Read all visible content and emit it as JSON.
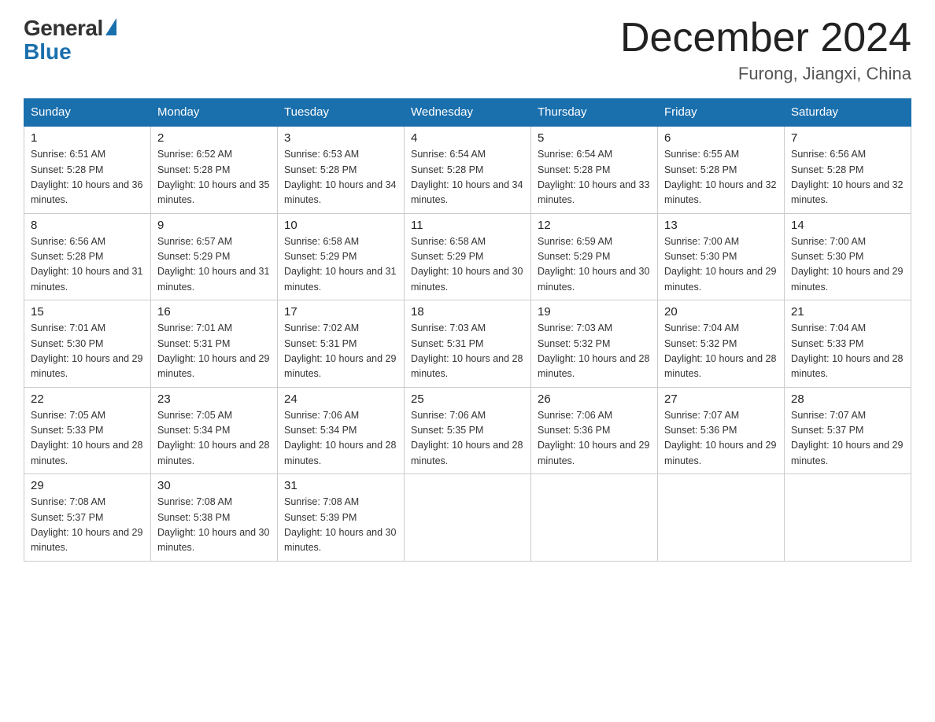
{
  "logo": {
    "general": "General",
    "blue": "Blue"
  },
  "title": {
    "month_year": "December 2024",
    "location": "Furong, Jiangxi, China"
  },
  "headers": [
    "Sunday",
    "Monday",
    "Tuesday",
    "Wednesday",
    "Thursday",
    "Friday",
    "Saturday"
  ],
  "weeks": [
    [
      {
        "day": "1",
        "sunrise": "6:51 AM",
        "sunset": "5:28 PM",
        "daylight": "10 hours and 36 minutes."
      },
      {
        "day": "2",
        "sunrise": "6:52 AM",
        "sunset": "5:28 PM",
        "daylight": "10 hours and 35 minutes."
      },
      {
        "day": "3",
        "sunrise": "6:53 AM",
        "sunset": "5:28 PM",
        "daylight": "10 hours and 34 minutes."
      },
      {
        "day": "4",
        "sunrise": "6:54 AM",
        "sunset": "5:28 PM",
        "daylight": "10 hours and 34 minutes."
      },
      {
        "day": "5",
        "sunrise": "6:54 AM",
        "sunset": "5:28 PM",
        "daylight": "10 hours and 33 minutes."
      },
      {
        "day": "6",
        "sunrise": "6:55 AM",
        "sunset": "5:28 PM",
        "daylight": "10 hours and 32 minutes."
      },
      {
        "day": "7",
        "sunrise": "6:56 AM",
        "sunset": "5:28 PM",
        "daylight": "10 hours and 32 minutes."
      }
    ],
    [
      {
        "day": "8",
        "sunrise": "6:56 AM",
        "sunset": "5:28 PM",
        "daylight": "10 hours and 31 minutes."
      },
      {
        "day": "9",
        "sunrise": "6:57 AM",
        "sunset": "5:29 PM",
        "daylight": "10 hours and 31 minutes."
      },
      {
        "day": "10",
        "sunrise": "6:58 AM",
        "sunset": "5:29 PM",
        "daylight": "10 hours and 31 minutes."
      },
      {
        "day": "11",
        "sunrise": "6:58 AM",
        "sunset": "5:29 PM",
        "daylight": "10 hours and 30 minutes."
      },
      {
        "day": "12",
        "sunrise": "6:59 AM",
        "sunset": "5:29 PM",
        "daylight": "10 hours and 30 minutes."
      },
      {
        "day": "13",
        "sunrise": "7:00 AM",
        "sunset": "5:30 PM",
        "daylight": "10 hours and 29 minutes."
      },
      {
        "day": "14",
        "sunrise": "7:00 AM",
        "sunset": "5:30 PM",
        "daylight": "10 hours and 29 minutes."
      }
    ],
    [
      {
        "day": "15",
        "sunrise": "7:01 AM",
        "sunset": "5:30 PM",
        "daylight": "10 hours and 29 minutes."
      },
      {
        "day": "16",
        "sunrise": "7:01 AM",
        "sunset": "5:31 PM",
        "daylight": "10 hours and 29 minutes."
      },
      {
        "day": "17",
        "sunrise": "7:02 AM",
        "sunset": "5:31 PM",
        "daylight": "10 hours and 29 minutes."
      },
      {
        "day": "18",
        "sunrise": "7:03 AM",
        "sunset": "5:31 PM",
        "daylight": "10 hours and 28 minutes."
      },
      {
        "day": "19",
        "sunrise": "7:03 AM",
        "sunset": "5:32 PM",
        "daylight": "10 hours and 28 minutes."
      },
      {
        "day": "20",
        "sunrise": "7:04 AM",
        "sunset": "5:32 PM",
        "daylight": "10 hours and 28 minutes."
      },
      {
        "day": "21",
        "sunrise": "7:04 AM",
        "sunset": "5:33 PM",
        "daylight": "10 hours and 28 minutes."
      }
    ],
    [
      {
        "day": "22",
        "sunrise": "7:05 AM",
        "sunset": "5:33 PM",
        "daylight": "10 hours and 28 minutes."
      },
      {
        "day": "23",
        "sunrise": "7:05 AM",
        "sunset": "5:34 PM",
        "daylight": "10 hours and 28 minutes."
      },
      {
        "day": "24",
        "sunrise": "7:06 AM",
        "sunset": "5:34 PM",
        "daylight": "10 hours and 28 minutes."
      },
      {
        "day": "25",
        "sunrise": "7:06 AM",
        "sunset": "5:35 PM",
        "daylight": "10 hours and 28 minutes."
      },
      {
        "day": "26",
        "sunrise": "7:06 AM",
        "sunset": "5:36 PM",
        "daylight": "10 hours and 29 minutes."
      },
      {
        "day": "27",
        "sunrise": "7:07 AM",
        "sunset": "5:36 PM",
        "daylight": "10 hours and 29 minutes."
      },
      {
        "day": "28",
        "sunrise": "7:07 AM",
        "sunset": "5:37 PM",
        "daylight": "10 hours and 29 minutes."
      }
    ],
    [
      {
        "day": "29",
        "sunrise": "7:08 AM",
        "sunset": "5:37 PM",
        "daylight": "10 hours and 29 minutes."
      },
      {
        "day": "30",
        "sunrise": "7:08 AM",
        "sunset": "5:38 PM",
        "daylight": "10 hours and 30 minutes."
      },
      {
        "day": "31",
        "sunrise": "7:08 AM",
        "sunset": "5:39 PM",
        "daylight": "10 hours and 30 minutes."
      },
      null,
      null,
      null,
      null
    ]
  ]
}
